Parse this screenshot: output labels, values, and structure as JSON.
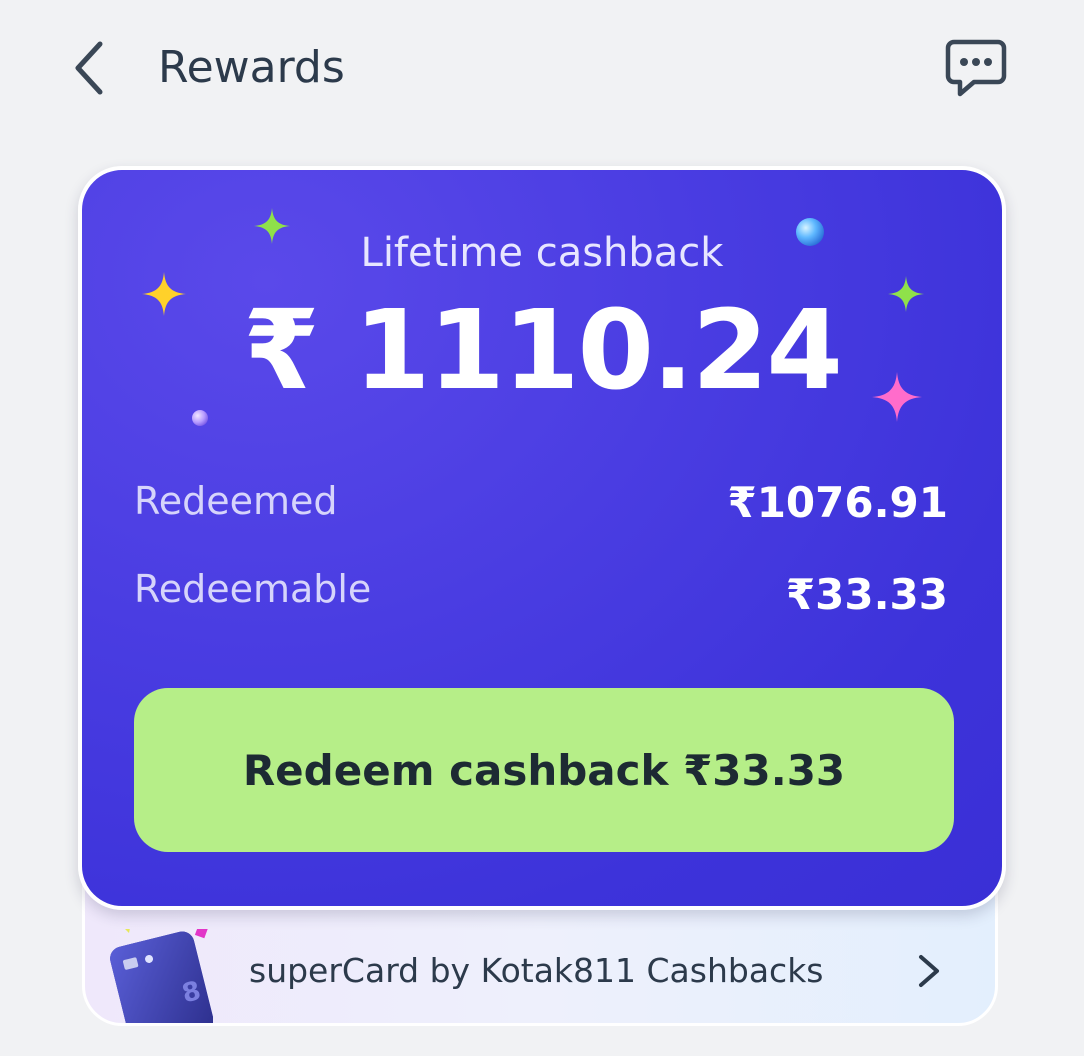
{
  "header": {
    "title": "Rewards",
    "back_icon": "chevron-left-icon",
    "chat_icon": "chat-bubble-icon"
  },
  "cashback_card": {
    "lifetime_label": "Lifetime cashback",
    "lifetime_value": "₹ 1110.24",
    "rows": [
      {
        "label": "Redeemed",
        "value": "₹1076.91"
      },
      {
        "label": "Redeemable",
        "value": "₹33.33"
      }
    ],
    "redeem_button_label": "Redeem cashback ₹33.33"
  },
  "offer_strip": {
    "label": "superCard by Kotak811 Cashbacks",
    "chevron_icon": "chevron-right-icon"
  },
  "colors": {
    "card_background": "#4a3de2",
    "button_background": "#b6ee88",
    "page_background": "#f1f2f4",
    "title_text": "#2c3a4b"
  }
}
